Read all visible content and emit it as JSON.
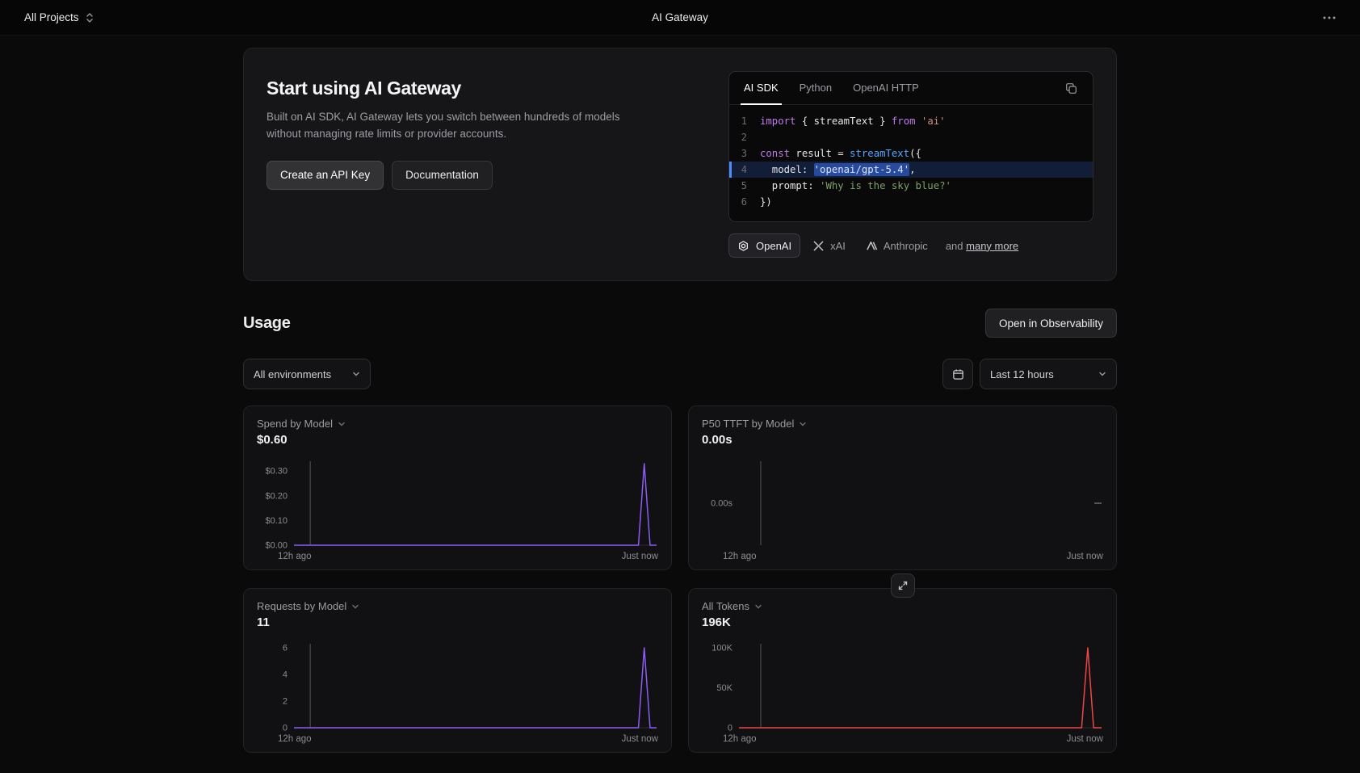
{
  "topbar": {
    "projects_label": "All Projects",
    "title": "AI Gateway"
  },
  "hero": {
    "title": "Start using AI Gateway",
    "description": "Built on AI SDK, AI Gateway lets you switch between hundreds of models without managing rate limits or provider accounts.",
    "buttons": {
      "create_key": "Create an API Key",
      "docs": "Documentation"
    },
    "code": {
      "tabs": [
        {
          "label": "AI SDK",
          "active": true
        },
        {
          "label": "Python",
          "active": false
        },
        {
          "label": "OpenAI HTTP",
          "active": false
        }
      ],
      "lines": [
        {
          "n": "1",
          "tokens": [
            {
              "c": "kw",
              "t": "import"
            },
            {
              "c": "pl",
              "t": " { streamText } "
            },
            {
              "c": "kw",
              "t": "from"
            },
            {
              "c": "s1",
              "t": " 'ai'"
            }
          ]
        },
        {
          "n": "2",
          "tokens": []
        },
        {
          "n": "3",
          "tokens": [
            {
              "c": "kw",
              "t": "const"
            },
            {
              "c": "pl",
              "t": " result = "
            },
            {
              "c": "fn",
              "t": "streamText"
            },
            {
              "c": "pl",
              "t": "({"
            }
          ]
        },
        {
          "n": "4",
          "hl": true,
          "tokens": [
            {
              "c": "pl",
              "t": "  model: "
            },
            {
              "c": "sel",
              "t": "'openai/gpt-5.4'"
            },
            {
              "c": "pl",
              "t": ","
            }
          ]
        },
        {
          "n": "5",
          "tokens": [
            {
              "c": "pl",
              "t": "  prompt: "
            },
            {
              "c": "s2",
              "t": "'Why is the sky blue?'"
            }
          ]
        },
        {
          "n": "6",
          "tokens": [
            {
              "c": "pl",
              "t": "})"
            }
          ]
        }
      ]
    },
    "providers": {
      "items": [
        {
          "name": "OpenAI",
          "active": true
        },
        {
          "name": "xAI",
          "active": false
        },
        {
          "name": "Anthropic",
          "active": false
        }
      ],
      "more_prefix": "and",
      "more_link": "many more"
    }
  },
  "usage": {
    "title": "Usage",
    "open_observability": "Open in Observability",
    "environment_filter": "All environments",
    "time_filter": "Last 12 hours"
  },
  "icons": {
    "project-switcher": "chevrons-up-down",
    "topbar-menu": "ellipsis",
    "code-copy": "copy",
    "filters": [
      "calendar",
      "chevron-down"
    ],
    "chart-header": "chevron-down",
    "chart-overlay": "expand-diagonal",
    "providers": [
      "openai-logo",
      "xai-logo",
      "anthropic-logo"
    ]
  },
  "chart_data": [
    {
      "type": "line",
      "title": "Spend by Model",
      "total_label": "$0.60",
      "x_labels": [
        "12h ago",
        "Just now"
      ],
      "ylabel": "USD",
      "y_max": 0.34,
      "y_ticks": [
        {
          "v": 0.3,
          "label": "$0.30"
        },
        {
          "v": 0.2,
          "label": "$0.20"
        },
        {
          "v": 0.1,
          "label": "$0.10"
        },
        {
          "v": 0.0,
          "label": "$0.00"
        }
      ],
      "baseline": true,
      "marker_x": 0.045,
      "series": [
        {
          "name": "spend",
          "color": "#8b5cf6",
          "points": [
            [
              0,
              0
            ],
            [
              0.95,
              0
            ],
            [
              0.966,
              0.33
            ],
            [
              0.982,
              0
            ],
            [
              1,
              0
            ]
          ]
        }
      ]
    },
    {
      "type": "line",
      "title": "P50 TTFT by Model",
      "total_label": "0.00s",
      "x_labels": [
        "12h ago",
        "Just now"
      ],
      "ylabel": "seconds",
      "y_max": null,
      "y_ticks": [
        {
          "v": 0,
          "label": "0.00s"
        }
      ],
      "baseline": false,
      "marker_x": 0.06,
      "right_dash": true,
      "series": []
    },
    {
      "type": "line",
      "title": "Requests by Model",
      "total_label": "11",
      "x_labels": [
        "12h ago",
        "Just now"
      ],
      "ylabel": "requests",
      "y_max": 6.3,
      "y_ticks": [
        {
          "v": 6,
          "label": "6"
        },
        {
          "v": 4,
          "label": "4"
        },
        {
          "v": 2,
          "label": "2"
        },
        {
          "v": 0,
          "label": "0"
        }
      ],
      "baseline": true,
      "marker_x": 0.045,
      "series": [
        {
          "name": "requests",
          "color": "#8b5cf6",
          "points": [
            [
              0,
              0
            ],
            [
              0.95,
              0
            ],
            [
              0.966,
              6
            ],
            [
              0.982,
              0
            ],
            [
              1,
              0
            ]
          ]
        }
      ]
    },
    {
      "type": "line",
      "title": "All Tokens",
      "total_label": "196K",
      "x_labels": [
        "12h ago",
        "Just now"
      ],
      "ylabel": "tokens",
      "y_max": 105000,
      "y_ticks": [
        {
          "v": 100000,
          "label": "100K"
        },
        {
          "v": 50000,
          "label": "50K"
        },
        {
          "v": 0,
          "label": "0"
        }
      ],
      "baseline": true,
      "marker_x": 0.06,
      "series": [
        {
          "name": "tokens",
          "color": "#ee4646",
          "points": [
            [
              0,
              0
            ],
            [
              0.945,
              0
            ],
            [
              0.962,
              100000
            ],
            [
              0.978,
              0
            ],
            [
              1,
              0
            ]
          ]
        }
      ]
    }
  ]
}
